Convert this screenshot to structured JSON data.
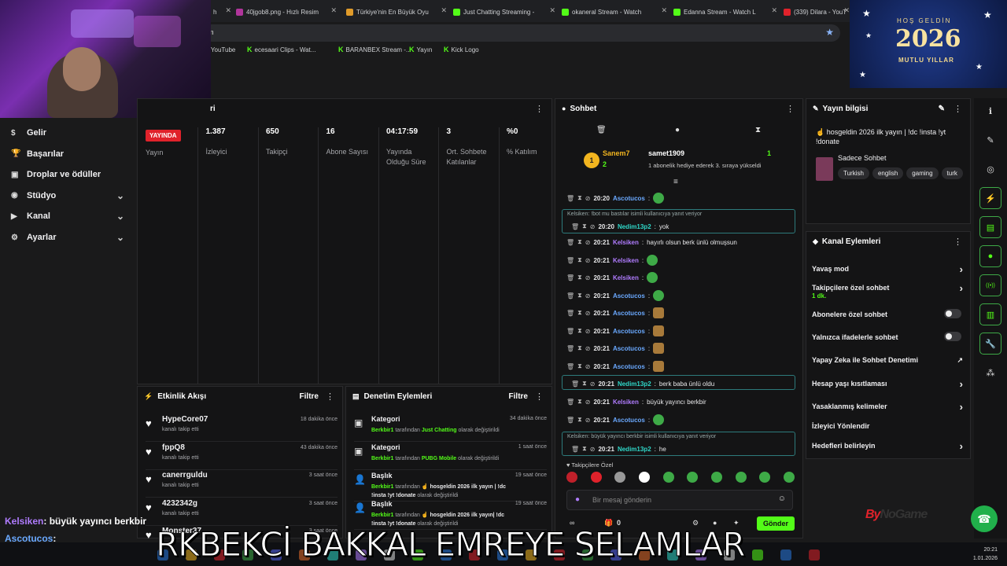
{
  "browser": {
    "tabs": [
      {
        "label": "h",
        "color": "#2a2a2d"
      },
      {
        "label": "40jgob8.png - Hızlı Resim",
        "color": "#b0359b"
      },
      {
        "label": "Türkiye'nin En Büyük Oyu",
        "color": "#e09b2a"
      },
      {
        "label": "Just Chatting Streaming -",
        "color": "#53fc18"
      },
      {
        "label": "okaneral Stream - Watch",
        "color": "#53fc18"
      },
      {
        "label": "Edanna Stream - Watch L",
        "color": "#53fc18"
      },
      {
        "label": "(339) Dilara - YouT",
        "color": "#e0222b"
      }
    ],
    "address": "m",
    "bookmarks": [
      "YouTube",
      "ecesaari Clips - Wat...",
      "BARANBEX Stream -...",
      "Yayın",
      "Kick Logo"
    ]
  },
  "newyear": {
    "greeting": "HOŞ GELDİN",
    "year": "2026",
    "wish": "MUTLU YILLAR"
  },
  "nav": {
    "items": [
      {
        "label": "Gelir",
        "icon": "$"
      },
      {
        "label": "Başarılar",
        "icon": "🏆"
      },
      {
        "label": "Droplar ve ödüller",
        "icon": "▣"
      },
      {
        "label": "Stüdyo",
        "icon": "◉"
      },
      {
        "label": "Kanal",
        "icon": "▶"
      },
      {
        "label": "Ayarlar",
        "icon": "⚙"
      }
    ]
  },
  "stats": {
    "title_fragment": "ri",
    "live_badge": "YAYINDA",
    "cols": [
      {
        "value": "",
        "label": "Yayın"
      },
      {
        "value": "1.387",
        "label": "İzleyici"
      },
      {
        "value": "650",
        "label": "Takipçi"
      },
      {
        "value": "16",
        "label": "Abone Sayısı"
      },
      {
        "value": "04:17:59",
        "label": "Yayında Olduğu Süre"
      },
      {
        "value": "3",
        "label": "Ort. Sohbete Katılanlar"
      },
      {
        "value": "%0",
        "label": "% Katılım"
      }
    ]
  },
  "activity": {
    "title": "Etkinlik Akışı",
    "filter": "Filtre",
    "items": [
      {
        "name": "HypeCore07",
        "sub": "kanalı takip etti",
        "time": "18 dakika önce"
      },
      {
        "name": "fppQ8",
        "sub": "kanalı takip etti",
        "time": "43 dakika önce"
      },
      {
        "name": "canerrguldu",
        "sub": "kanalı takip etti",
        "time": "3 saat önce"
      },
      {
        "name": "4232342g",
        "sub": "kanalı takip etti",
        "time": "3 saat önce"
      },
      {
        "name": "Monster37",
        "sub": "",
        "time": "3 saat önce"
      }
    ]
  },
  "moderation": {
    "title": "Denetim Eylemleri",
    "filter": "Filtre",
    "items": [
      {
        "title": "Kategori",
        "time": "34 dakika önce",
        "user": "Berkbir1",
        "mid": " tarafından ",
        "value": "Just Chatting",
        "tail": " olarak değiştirildi",
        "value2": "",
        "tail2": ""
      },
      {
        "title": "Kategori",
        "time": "1 saat önce",
        "user": "Berkbir1",
        "mid": " tarafından ",
        "value": "PUBG Mobile",
        "tail": " olarak değiştirildi",
        "value2": "",
        "tail2": ""
      },
      {
        "title": "Başlık",
        "time": "19 saat önce",
        "user": "Berkbir1",
        "mid": " tarafından ",
        "value": "☝️ hosgeldin 2026 ilk yayın | !dc",
        "tail": "",
        "value2": "!insta !yt !donate",
        "tail2": " olarak değiştirildi"
      },
      {
        "title": "Başlık",
        "time": "19 saat önce",
        "user": "Berkbir1",
        "mid": " tarafından ",
        "value": "☝️ hosgeldin 2026 ilk yayın| !dc",
        "tail": "",
        "value2": "!insta !yt !donate",
        "tail2": " olarak değiştirildi"
      }
    ]
  },
  "chat": {
    "title": "Sohbet",
    "pinned": {
      "rank": "1",
      "user1": "Sanem7",
      "count1": "2",
      "user2": "samet1909",
      "count2": "1",
      "note": "1 abonelik hediye ederek 3. sıraya yükseldi"
    },
    "messages": [
      {
        "time": "20:20",
        "user": "Ascotucos",
        "color": "#6aa9ff",
        "text": "",
        "emote": "green"
      },
      {
        "reply": "Kelsiken: !bot mu bastılar isimli kullanıcıya yanıt veriyor",
        "time": "20:20",
        "user": "Nedim13p2",
        "color": "#2fd7c8",
        "text": "yok"
      },
      {
        "time": "20:21",
        "user": "Kelsiken",
        "color": "#b07cff",
        "text": "hayırlı olsun berk ünlü olmuşsun"
      },
      {
        "time": "20:21",
        "user": "Kelsiken",
        "color": "#b07cff",
        "text": "",
        "emote": "green"
      },
      {
        "time": "20:21",
        "user": "Kelsiken",
        "color": "#b07cff",
        "text": "",
        "emote": "green"
      },
      {
        "time": "20:21",
        "user": "Ascotucos",
        "color": "#6aa9ff",
        "text": "",
        "emote": "green"
      },
      {
        "time": "20:21",
        "user": "Ascotucos",
        "color": "#6aa9ff",
        "text": "",
        "emote": "brown"
      },
      {
        "time": "20:21",
        "user": "Ascotucos",
        "color": "#6aa9ff",
        "text": "",
        "emote": "brown"
      },
      {
        "time": "20:21",
        "user": "Ascotucos",
        "color": "#6aa9ff",
        "text": "",
        "emote": "brown"
      },
      {
        "time": "20:21",
        "user": "Ascotucos",
        "color": "#6aa9ff",
        "text": "",
        "emote": "brown"
      },
      {
        "time": "20:21",
        "user": "Nedim13p2",
        "color": "#2fd7c8",
        "text": "berk baba ünlü oldu",
        "boxed": true
      },
      {
        "time": "20:21",
        "user": "Kelsiken",
        "color": "#b07cff",
        "text": "büyük yayıncı berkbir"
      },
      {
        "time": "20:21",
        "user": "Ascotucos",
        "color": "#6aa9ff",
        "text": "",
        "emote": "green"
      },
      {
        "reply": "Kelsiken: büyük yayıncı berkbir isimli kullanıcıya yanıt veriyor",
        "time": "20:21",
        "user": "Nedim13p2",
        "color": "#2fd7c8",
        "text": "he"
      }
    ],
    "followers_only": "Takipçilere Özel",
    "input_placeholder": "Bir mesaj gönderin",
    "points": "0",
    "send": "Gönder"
  },
  "info": {
    "title": "Yayın bilgisi",
    "stream_title": "☝️ hosgeldin 2026 ilk yayın | !dc !insta !yt !donate",
    "category": "Sadece Sohbet",
    "tags": [
      "Turkish",
      "english",
      "gaming",
      "turk"
    ]
  },
  "actions": {
    "title": "Kanal Eylemleri",
    "rows": [
      {
        "label": "Yavaş mod",
        "kind": "chevron"
      },
      {
        "label": "Takipçilere özel sohbet",
        "sub": "1 dk.",
        "kind": "chevron"
      },
      {
        "label": "Abonelere özel sohbet",
        "kind": "toggle"
      },
      {
        "label": "Yalnızca ifadelerle sohbet",
        "kind": "toggle"
      },
      {
        "label": "Yapay Zeka ile Sohbet Denetimi",
        "kind": "external"
      },
      {
        "label": "Hesap yaşı kısıtlaması",
        "kind": "chevron"
      },
      {
        "label": "Yasaklanmış kelimeler",
        "kind": "chevron"
      },
      {
        "label": "İzleyici Yönlendir",
        "kind": "none"
      },
      {
        "label": "Hedefleri belirleyin",
        "kind": "chevron"
      }
    ]
  },
  "overlay": {
    "chat": [
      {
        "user": "Kelsiken",
        "text": ": büyük yayıncı berkbir",
        "color": "#b07cff"
      },
      {
        "user": "Ascotucos",
        "text": ":",
        "color": "#6aa9ff"
      },
      {
        "user": "Nedim13p2",
        "text": ": he",
        "color": "#2fd7c8"
      }
    ],
    "banner": "RKBEKCİ BAKKAL EMREYE SELAMLAR",
    "brand_a": "By",
    "brand_b": "NoGame"
  },
  "taskbar": {
    "time": "20:21",
    "date": "1.01.2026"
  },
  "colors": {
    "accent": "#53fc18",
    "live": "#e0222b"
  }
}
